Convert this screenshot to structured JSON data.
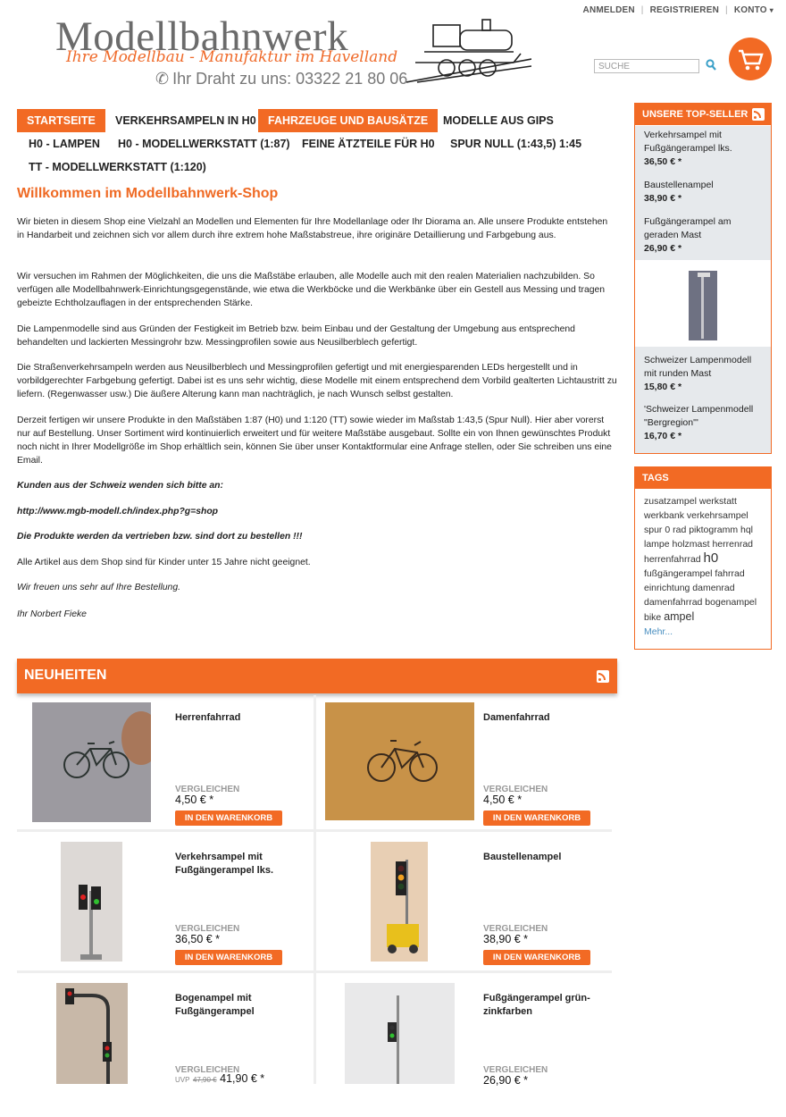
{
  "header": {
    "logo_title": "Modellbahnwerk",
    "logo_tagline": "Ihre Modellbau - Manufaktur im Havelland",
    "logo_phone": "Ihr Draht zu uns: 03322 21 80 06",
    "links": [
      "ANMELDEN",
      "REGISTRIEREN",
      "KONTO"
    ],
    "search_placeholder": "SUCHE"
  },
  "nav": [
    "STARTSEITE",
    "VERKEHRSAMPELN IN H0",
    "FAHRZEUGE UND BAUSÄTZE",
    "MODELLE AUS GIPS",
    "H0 - LAMPEN",
    "H0 - MODELLWERKSTATT (1:87)",
    "FEINE ÄTZTEILE FÜR H0",
    "SPUR NULL (1:43,5) 1:45",
    "TT - MODELLWERKSTATT (1:120)"
  ],
  "main": {
    "title": "Willkommen im Modellbahnwerk-Shop",
    "p1": "Wir bieten in diesem Shop eine Vielzahl an Modellen und Elementen für Ihre Modellanlage oder Ihr Diorama an. Alle unsere Produkte entstehen in Handarbeit und zeichnen sich vor allem durch ihre extrem hohe Maßstabstreue, ihre originäre Detaillierung und Farbgebung aus.",
    "p2": "Wir versuchen im Rahmen der Möglichkeiten, die uns die Maßstäbe erlauben, alle Modelle auch mit den realen Materialien nachzubilden. So verfügen alle Modellbahnwerk-Einrichtungsgegenstände, wie etwa die Werkböcke und die Werkbänke über ein Gestell aus Messing und tragen gebeizte Echtholzauflagen in der entsprechenden Stärke.",
    "p3": "Die Lampenmodelle sind aus Gründen der Festigkeit im Betrieb bzw. beim Einbau und der Gestaltung der Umgebung aus entsprechend behandelten und lackierten Messingrohr bzw. Messingprofilen sowie aus Neusilberblech gefertigt.",
    "p4": "Die Straßenverkehrsampeln werden aus Neusilberblech und Messingprofilen gefertigt und mit energiesparenden LEDs hergestellt und in vorbildgerechter Farbgebung gefertigt. Dabei ist es uns sehr wichtig, diese Modelle mit einem entsprechend dem Vorbild gealterten Lichtaustritt zu liefern. (Regenwasser usw.) Die äußere Alterung kann man nachträglich, je nach Wunsch selbst gestalten.",
    "p5": "Derzeit fertigen wir unsere Produkte in den Maßstäben 1:87 (H0) und 1:120 (TT) sowie wieder im Maßstab 1:43,5 (Spur Null). Hier aber vorerst nur auf Bestellung. Unser Sortiment wird kontinuierlich erweitert und für weitere Maßstäbe ausgebaut. Sollte ein von Ihnen gewünschtes Produkt noch nicht in Ihrer Modellgröße im Shop erhältlich sein, können Sie über unser Kontaktformular eine Anfrage stellen, oder Sie schreiben uns eine Email.",
    "p6": "Kunden aus der Schweiz wenden sich bitte an:",
    "p7": "http://www.mgb-modell.ch/index.php?g=shop",
    "p8": "Die Produkte werden da vertrieben bzw. sind dort zu bestellen !!!",
    "p9": " Alle Artikel aus dem Shop sind für Kinder unter 15 Jahre nicht geeignet.",
    "p10": "Wir freuen uns sehr auf Ihre Bestellung.",
    "p11": "Ihr Norbert Fieke"
  },
  "neuheiten": {
    "title": "NEUHEITEN",
    "compare_label": "VERGLEICHEN",
    "cart_label": "IN DEN WARENKORB",
    "uvp_label": "UVP",
    "products": [
      {
        "name": "Herrenfahrrad",
        "price": "4,50 € *"
      },
      {
        "name": "Damenfahrrad",
        "price": "4,50 € *"
      },
      {
        "name": "Verkehrsampel mit Fußgängerampel lks.",
        "price": "36,50 € *"
      },
      {
        "name": "Baustellenampel",
        "price": "38,90 € *"
      },
      {
        "name": "Bogenampel mit Fußgängerampel",
        "price": "41,90 € *",
        "old_price": "47,90 €"
      },
      {
        "name": "Fußgängerampel grün-zinkfarben",
        "price": "26,90 € *"
      }
    ]
  },
  "topseller": {
    "title": "UNSERE TOP-SELLER",
    "items": [
      {
        "name": "Verkehrsampel mit Fußgängerampel lks.",
        "price": "36,50 € *"
      },
      {
        "name": "Baustellenampel",
        "price": "38,90 € *"
      },
      {
        "name": "Fußgängerampel am geraden Mast",
        "price": "26,90 € *"
      },
      {
        "name": "Schweizer Lampenmodell mit runden Mast",
        "price": "15,80 € *"
      },
      {
        "name": "'Schweizer Lampenmodell \"Bergregion\"'",
        "price": "16,70 € *"
      }
    ]
  },
  "tags": {
    "title": "TAGS",
    "list": [
      "zusatzampel",
      "werkstatt",
      "werkbank",
      "verkehrsampel",
      "spur 0",
      "rad",
      "piktogramm",
      "hql",
      "lampe",
      "holzmast",
      "herrenrad",
      "herrenfahrrad",
      "h0",
      "fußgängerampel",
      "fahrrad",
      "einrichtung",
      "damenrad",
      "damenfahrrad",
      "bogenampel",
      "bike",
      "ampel"
    ],
    "more": "Mehr..."
  },
  "colors": {
    "accent": "#f26a24",
    "text": "#222222"
  }
}
